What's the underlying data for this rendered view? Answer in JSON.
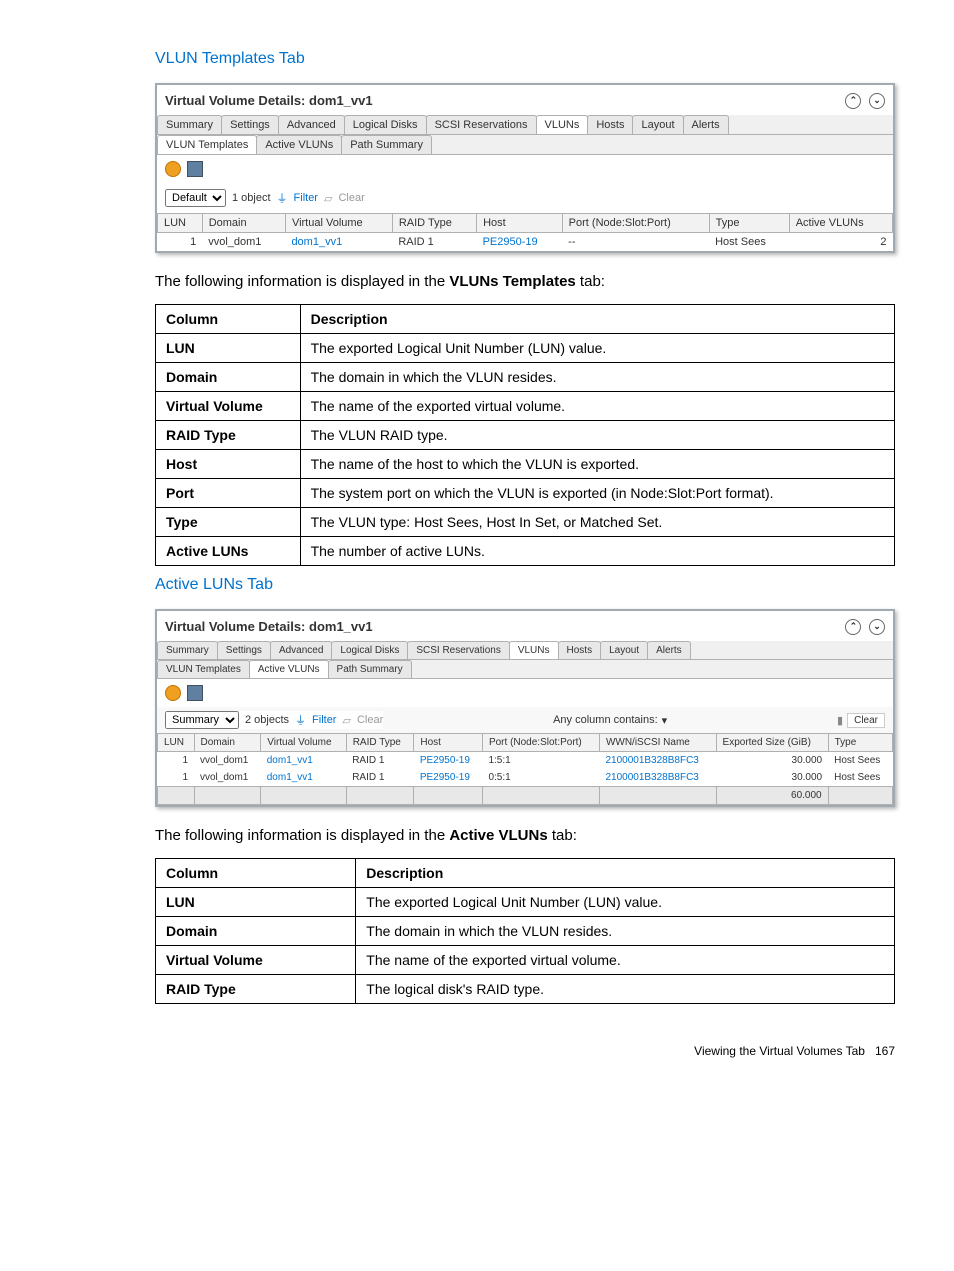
{
  "sections": {
    "vlun_title": "VLUN Templates Tab",
    "active_title": "Active LUNs Tab"
  },
  "screenshot1": {
    "title": "Virtual Volume Details: dom1_vv1",
    "tabs": [
      "Summary",
      "Settings",
      "Advanced",
      "Logical Disks",
      "SCSI Reservations",
      "VLUNs",
      "Hosts",
      "Layout",
      "Alerts"
    ],
    "tabs_active_index": 5,
    "subtabs": [
      "VLUN Templates",
      "Active VLUNs",
      "Path Summary"
    ],
    "subtabs_active_index": 0,
    "view_select": "Default",
    "object_count": "1 object",
    "filter_label": "Filter",
    "clear_label": "Clear",
    "columns": [
      "LUN",
      "Domain",
      "Virtual Volume",
      "RAID Type",
      "Host",
      "Port (Node:Slot:Port)",
      "Type",
      "Active VLUNs"
    ],
    "rows": [
      {
        "lun": "1",
        "domain": "vvol_dom1",
        "vv": "dom1_vv1",
        "raid": "RAID 1",
        "host": "PE2950-19",
        "port": "--",
        "type": "Host Sees",
        "active": "2"
      }
    ]
  },
  "text1_intro_a": "The following information is displayed in the ",
  "text1_intro_b": "VLUNs Templates",
  "text1_intro_c": " tab:",
  "doc_table1": {
    "headers": [
      "Column",
      "Description"
    ],
    "rows": [
      [
        "LUN",
        "The exported Logical Unit Number (LUN) value."
      ],
      [
        "Domain",
        "The domain in which the VLUN resides."
      ],
      [
        "Virtual Volume",
        "The name of the exported virtual volume."
      ],
      [
        "RAID Type",
        "The VLUN RAID type."
      ],
      [
        "Host",
        "The name of the host to which the VLUN is exported."
      ],
      [
        "Port",
        "The system port on which the VLUN is exported (in Node:Slot:Port format)."
      ],
      [
        "Type",
        "The VLUN type: Host Sees, Host In Set, or Matched Set."
      ],
      [
        "Active LUNs",
        "The number of active LUNs."
      ]
    ]
  },
  "screenshot2": {
    "title": "Virtual Volume Details: dom1_vv1",
    "tabs": [
      "Summary",
      "Settings",
      "Advanced",
      "Logical Disks",
      "SCSI Reservations",
      "VLUNs",
      "Hosts",
      "Layout",
      "Alerts"
    ],
    "tabs_active_index": 5,
    "subtabs": [
      "VLUN Templates",
      "Active VLUNs",
      "Path Summary"
    ],
    "subtabs_active_index": 1,
    "view_select": "Summary",
    "object_count": "2 objects",
    "filter_label": "Filter",
    "clear_label": "Clear",
    "anycol_label": "Any column contains:",
    "columns": [
      "LUN",
      "Domain",
      "Virtual Volume",
      "RAID Type",
      "Host",
      "Port (Node:Slot:Port)",
      "WWN/iSCSI Name",
      "Exported Size (GiB)",
      "Type"
    ],
    "rows": [
      {
        "lun": "1",
        "domain": "vvol_dom1",
        "vv": "dom1_vv1",
        "raid": "RAID 1",
        "host": "PE2950-19",
        "port": "1:5:1",
        "wwn": "2100001B328B8FC3",
        "size": "30.000",
        "type": "Host Sees"
      },
      {
        "lun": "1",
        "domain": "vvol_dom1",
        "vv": "dom1_vv1",
        "raid": "RAID 1",
        "host": "PE2950-19",
        "port": "0:5:1",
        "wwn": "2100001B328B8FC3",
        "size": "30.000",
        "type": "Host Sees"
      }
    ],
    "total": "60.000"
  },
  "text2_intro_a": "The following information is displayed in the ",
  "text2_intro_b": "Active VLUNs",
  "text2_intro_c": " tab:",
  "doc_table2": {
    "headers": [
      "Column",
      "Description"
    ],
    "rows": [
      [
        "LUN",
        "The exported Logical Unit Number (LUN) value."
      ],
      [
        "Domain",
        "The domain in which the VLUN resides."
      ],
      [
        "Virtual Volume",
        "The name of the exported virtual volume."
      ],
      [
        "RAID Type",
        "The logical disk's RAID type."
      ]
    ]
  },
  "footer_text": "Viewing the Virtual Volumes Tab",
  "footer_page": "167"
}
